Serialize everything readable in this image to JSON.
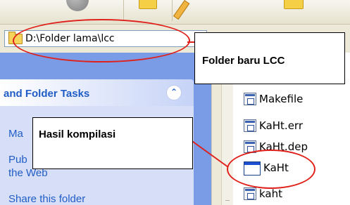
{
  "address_bar": {
    "path": "D:\\Folder lama\\lcc"
  },
  "task_pane": {
    "title": "and Folder Tasks",
    "links": [
      "Ma",
      "Pub",
      "the Web",
      "Share this folder"
    ]
  },
  "files": [
    {
      "name": "Makefile",
      "icon": "text-file-icon"
    },
    {
      "name": "KaHt.err",
      "icon": "text-file-icon"
    },
    {
      "name": "KaHt.dep",
      "icon": "text-file-icon"
    },
    {
      "name": "KaHt",
      "icon": "application-exe-icon"
    },
    {
      "name": "kaht",
      "icon": "text-file-icon"
    }
  ],
  "annotations": {
    "folder_note": "Folder baru LCC",
    "compile_note": "Hasil kompilasi"
  },
  "colors": {
    "annotation_ring": "#e0201a",
    "task_pane_blue": "#7a9be6",
    "link_blue": "#215dc6"
  }
}
